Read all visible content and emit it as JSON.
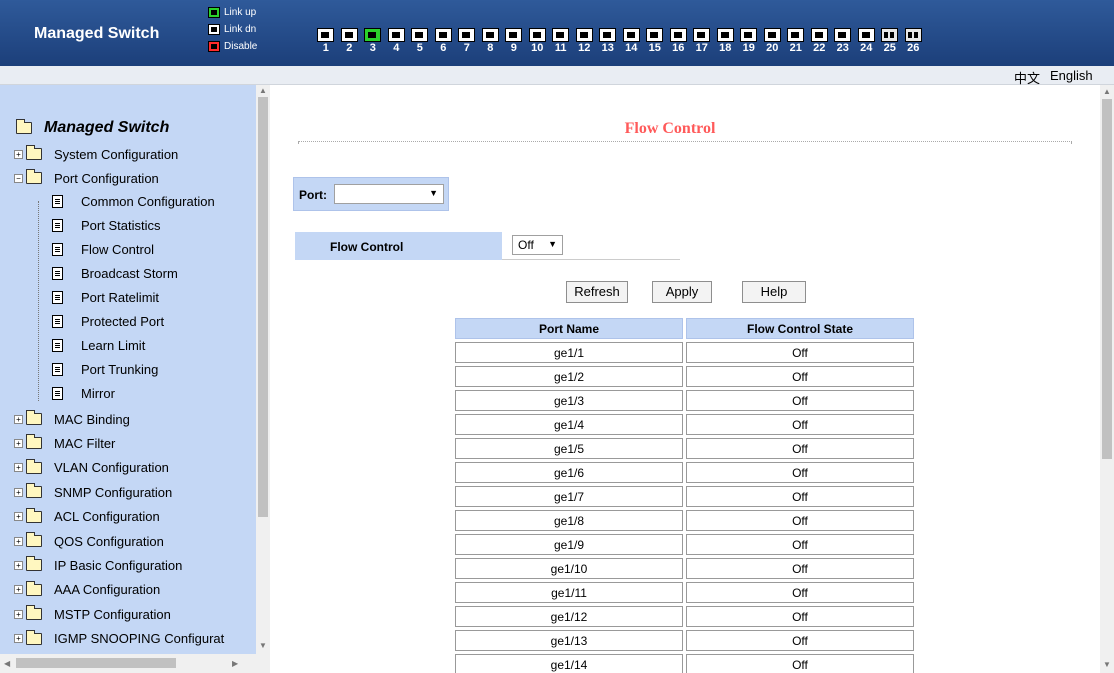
{
  "header": {
    "brand": "Managed Switch",
    "legend": [
      {
        "label": "Link up",
        "state": "up"
      },
      {
        "label": "Link dn",
        "state": "down"
      },
      {
        "label": "Disable",
        "state": "disabled"
      }
    ],
    "ports": [
      "1",
      "2",
      "3",
      "4",
      "5",
      "6",
      "7",
      "8",
      "9",
      "10",
      "11",
      "12",
      "13",
      "14",
      "15",
      "16",
      "17",
      "18",
      "19",
      "20",
      "21",
      "22",
      "23",
      "24",
      "25",
      "26"
    ],
    "colors": {
      "header_bg": "#1c3f7a",
      "link_up": "#2bd12b",
      "disabled": "#ff2b2b"
    }
  },
  "langbar": {
    "chinese": "中文",
    "english": "English"
  },
  "sidebar": {
    "title": "Managed Switch",
    "items": [
      {
        "label": "System Configuration",
        "expanded": false
      },
      {
        "label": "Port Configuration",
        "expanded": true
      }
    ],
    "port_children": [
      "Common Configuration",
      "Port Statistics",
      "Flow Control",
      "Broadcast Storm",
      "Port Ratelimit",
      "Protected Port",
      "Learn Limit",
      "Port Trunking",
      "Mirror"
    ],
    "more_items": [
      "MAC Binding",
      "MAC Filter",
      "VLAN Configuration",
      "SNMP Configuration",
      "ACL Configuration",
      "QOS Configuration",
      "IP Basic Configuration",
      "AAA Configuration",
      "MSTP Configuration",
      "IGMP SNOOPING Configurat"
    ]
  },
  "main": {
    "title": "Flow Control",
    "port_label": "Port:",
    "port_value": "",
    "flow_label": "Flow Control",
    "flow_value": "Off",
    "buttons": {
      "refresh": "Refresh",
      "apply": "Apply",
      "help": "Help"
    },
    "table": {
      "headers": [
        "Port Name",
        "Flow Control State"
      ],
      "rows": [
        [
          "ge1/1",
          "Off"
        ],
        [
          "ge1/2",
          "Off"
        ],
        [
          "ge1/3",
          "Off"
        ],
        [
          "ge1/4",
          "Off"
        ],
        [
          "ge1/5",
          "Off"
        ],
        [
          "ge1/6",
          "Off"
        ],
        [
          "ge1/7",
          "Off"
        ],
        [
          "ge1/8",
          "Off"
        ],
        [
          "ge1/9",
          "Off"
        ],
        [
          "ge1/10",
          "Off"
        ],
        [
          "ge1/11",
          "Off"
        ],
        [
          "ge1/12",
          "Off"
        ],
        [
          "ge1/13",
          "Off"
        ],
        [
          "ge1/14",
          "Off"
        ]
      ]
    }
  }
}
